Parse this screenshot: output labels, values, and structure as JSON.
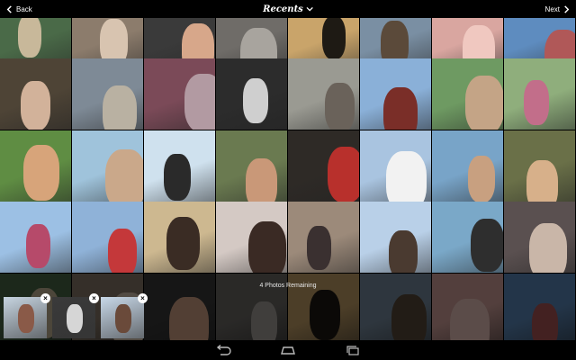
{
  "topbar": {
    "back_label": "Back",
    "title": "Recents",
    "next_label": "Next"
  },
  "tray": {
    "remaining_text": "4 Photos Remaining",
    "close_glyph": "×"
  },
  "icons": {
    "back": "chevron-left-icon",
    "next": "chevron-right-icon",
    "dropdown": "chevron-down-icon",
    "sys_back": "android-back-icon",
    "sys_home": "android-home-icon",
    "sys_recents": "android-recents-icon"
  },
  "photos": [
    {
      "bg": "#4a6a48",
      "fg": "#c8b89a"
    },
    {
      "bg": "#8c7c6c",
      "fg": "#d8c4b0"
    },
    {
      "bg": "#3a3a3a",
      "fg": "#d7a78a"
    },
    {
      "bg": "#6f6c68",
      "fg": "#a8a49e"
    },
    {
      "bg": "#c9a46a",
      "fg": "#1e1a14"
    },
    {
      "bg": "#7a8fa3",
      "fg": "#5b4a3a"
    },
    {
      "bg": "#d9a6a0",
      "fg": "#f0c8c0"
    },
    {
      "bg": "#5e8cbf",
      "fg": "#b05858"
    },
    {
      "bg": "#4e4436",
      "fg": "#d2b29a"
    },
    {
      "bg": "#7e8a96",
      "fg": "#b9b1a2"
    },
    {
      "bg": "#7b4a58",
      "fg": "#b29aa2"
    },
    {
      "bg": "#2c2c2c",
      "fg": "#cfcfcf"
    },
    {
      "bg": "#9a9a92",
      "fg": "#6a625a"
    },
    {
      "bg": "#8ab0d8",
      "fg": "#7a2e28"
    },
    {
      "bg": "#6e9a62",
      "fg": "#c4a486"
    },
    {
      "bg": "#8fae7c",
      "fg": "#c26e8a"
    },
    {
      "bg": "#5f8d43",
      "fg": "#d7a47a"
    },
    {
      "bg": "#9fc3db",
      "fg": "#caa88a"
    },
    {
      "bg": "#cfe1ee",
      "fg": "#2a2a2a"
    },
    {
      "bg": "#6a7a50",
      "fg": "#c99878"
    },
    {
      "bg": "#2e2a26",
      "fg": "#b8302c"
    },
    {
      "bg": "#a9c4e0",
      "fg": "#f2f2f2"
    },
    {
      "bg": "#78a4c8",
      "fg": "#c8a080"
    },
    {
      "bg": "#6a7048",
      "fg": "#d7b08a"
    },
    {
      "bg": "#9cc0e4",
      "fg": "#b64a6a"
    },
    {
      "bg": "#8fb2d8",
      "fg": "#c4383a"
    },
    {
      "bg": "#cdb890",
      "fg": "#3a2c24"
    },
    {
      "bg": "#d4c9c4",
      "fg": "#3a2a24"
    },
    {
      "bg": "#9c8a7a",
      "fg": "#3a3030"
    },
    {
      "bg": "#b9d0e8",
      "fg": "#4a3a30"
    },
    {
      "bg": "#7aa8c8",
      "fg": "#2e2e2e"
    },
    {
      "bg": "#5a5050",
      "fg": "#c9b6a8"
    }
  ],
  "tray_photos": [
    {
      "bg": "#c6d4e0",
      "fg": "#8a5a48"
    },
    {
      "bg": "#3a3a3a",
      "fg": "#d6d6d6"
    },
    {
      "bg": "#c8d8e8",
      "fg": "#6a4a3a"
    }
  ]
}
